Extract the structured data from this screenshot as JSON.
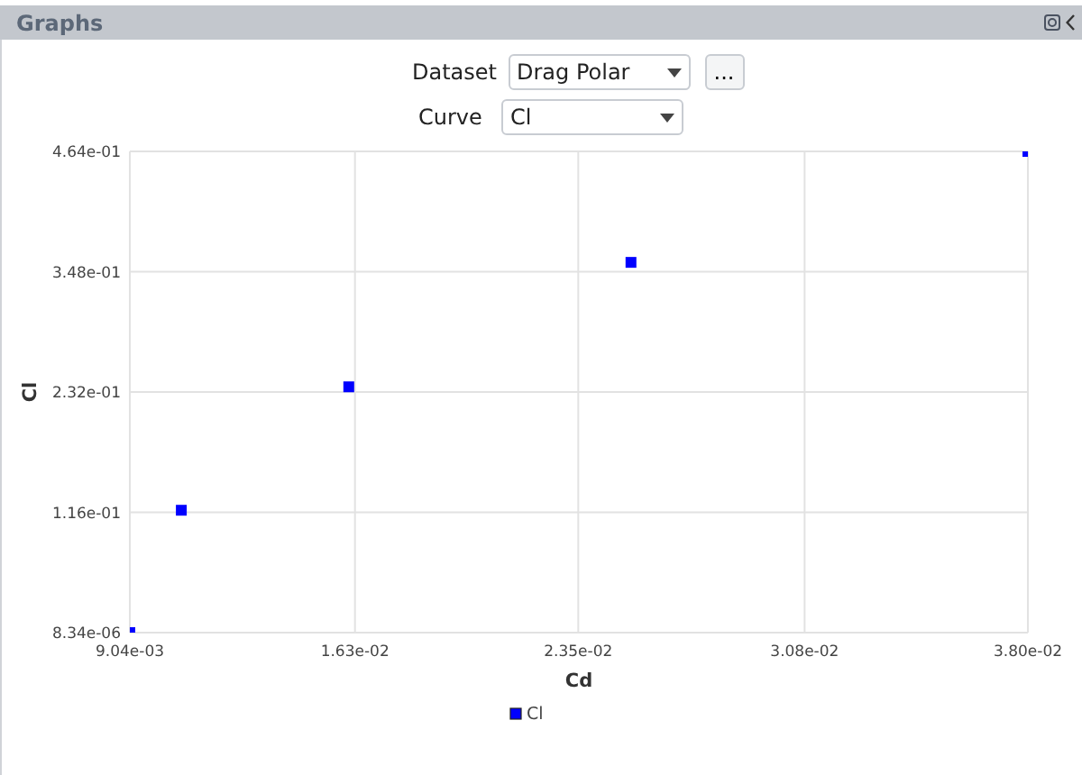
{
  "panel": {
    "title": "Graphs"
  },
  "controls": [
    {
      "label": "Dataset",
      "value": "Drag Polar",
      "more": "..."
    },
    {
      "label": "Curve",
      "value": "Cl"
    }
  ],
  "chart_data": {
    "type": "scatter",
    "grid": true,
    "xlabel": "Cd",
    "ylabel": "Cl",
    "xlim": [
      0.00904,
      0.038
    ],
    "ylim": [
      8.34e-06,
      0.464
    ],
    "xticks": [
      {
        "value": 0.00904,
        "label": "9.04e-03"
      },
      {
        "value": 0.0163,
        "label": "1.63e-02"
      },
      {
        "value": 0.0235,
        "label": "2.35e-02"
      },
      {
        "value": 0.0308,
        "label": "3.08e-02"
      },
      {
        "value": 0.038,
        "label": "3.80e-02"
      }
    ],
    "yticks": [
      {
        "value": 8.34e-06,
        "label": "8.34e-06"
      },
      {
        "value": 0.116,
        "label": "1.16e-01"
      },
      {
        "value": 0.232,
        "label": "2.32e-01"
      },
      {
        "value": 0.348,
        "label": "3.48e-01"
      },
      {
        "value": 0.464,
        "label": "4.64e-01"
      }
    ],
    "x": [
      0.00904,
      0.0107,
      0.0161,
      0.0252,
      0.038
    ],
    "series": [
      {
        "name": "Cl",
        "color": "#0000ff",
        "values": [
          8.34e-06,
          0.118,
          0.237,
          0.357,
          0.464
        ]
      }
    ]
  }
}
